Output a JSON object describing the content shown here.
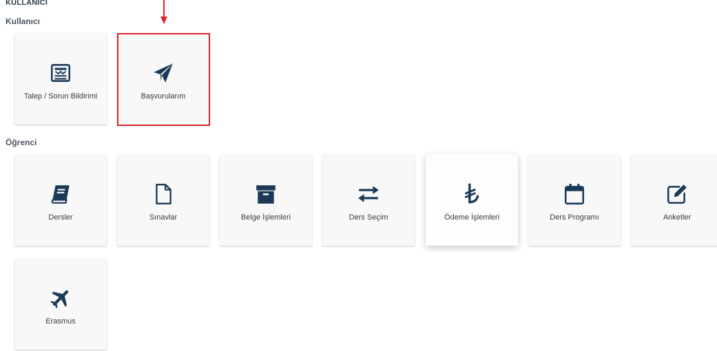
{
  "page": {
    "section_header": "KULLANICI"
  },
  "groups": {
    "user": {
      "title": "Kullanıcı",
      "cards": [
        {
          "label": "Talep / Sorun Bildirimi",
          "icon": "newspaper-icon"
        },
        {
          "label": "Başvurularım",
          "icon": "paper-plane-icon"
        }
      ]
    },
    "student": {
      "title": "Öğrenci",
      "cards": [
        {
          "label": "Dersler",
          "icon": "book-icon"
        },
        {
          "label": "Sınavlar",
          "icon": "file-icon"
        },
        {
          "label": "Belge İşlemleri",
          "icon": "archive-box-icon"
        },
        {
          "label": "Ders Seçim",
          "icon": "exchange-arrows-icon"
        },
        {
          "label": "Ödeme İşlemleri",
          "icon": "lira-icon"
        },
        {
          "label": "Ders Programı",
          "icon": "calendar-icon"
        },
        {
          "label": "Anketler",
          "icon": "edit-icon"
        },
        {
          "label": "Erasmus",
          "icon": "plane-icon"
        }
      ]
    }
  },
  "colors": {
    "icon": "#1b3a57",
    "highlight": "#d9232d",
    "card_bg": "#f8f8f8"
  }
}
